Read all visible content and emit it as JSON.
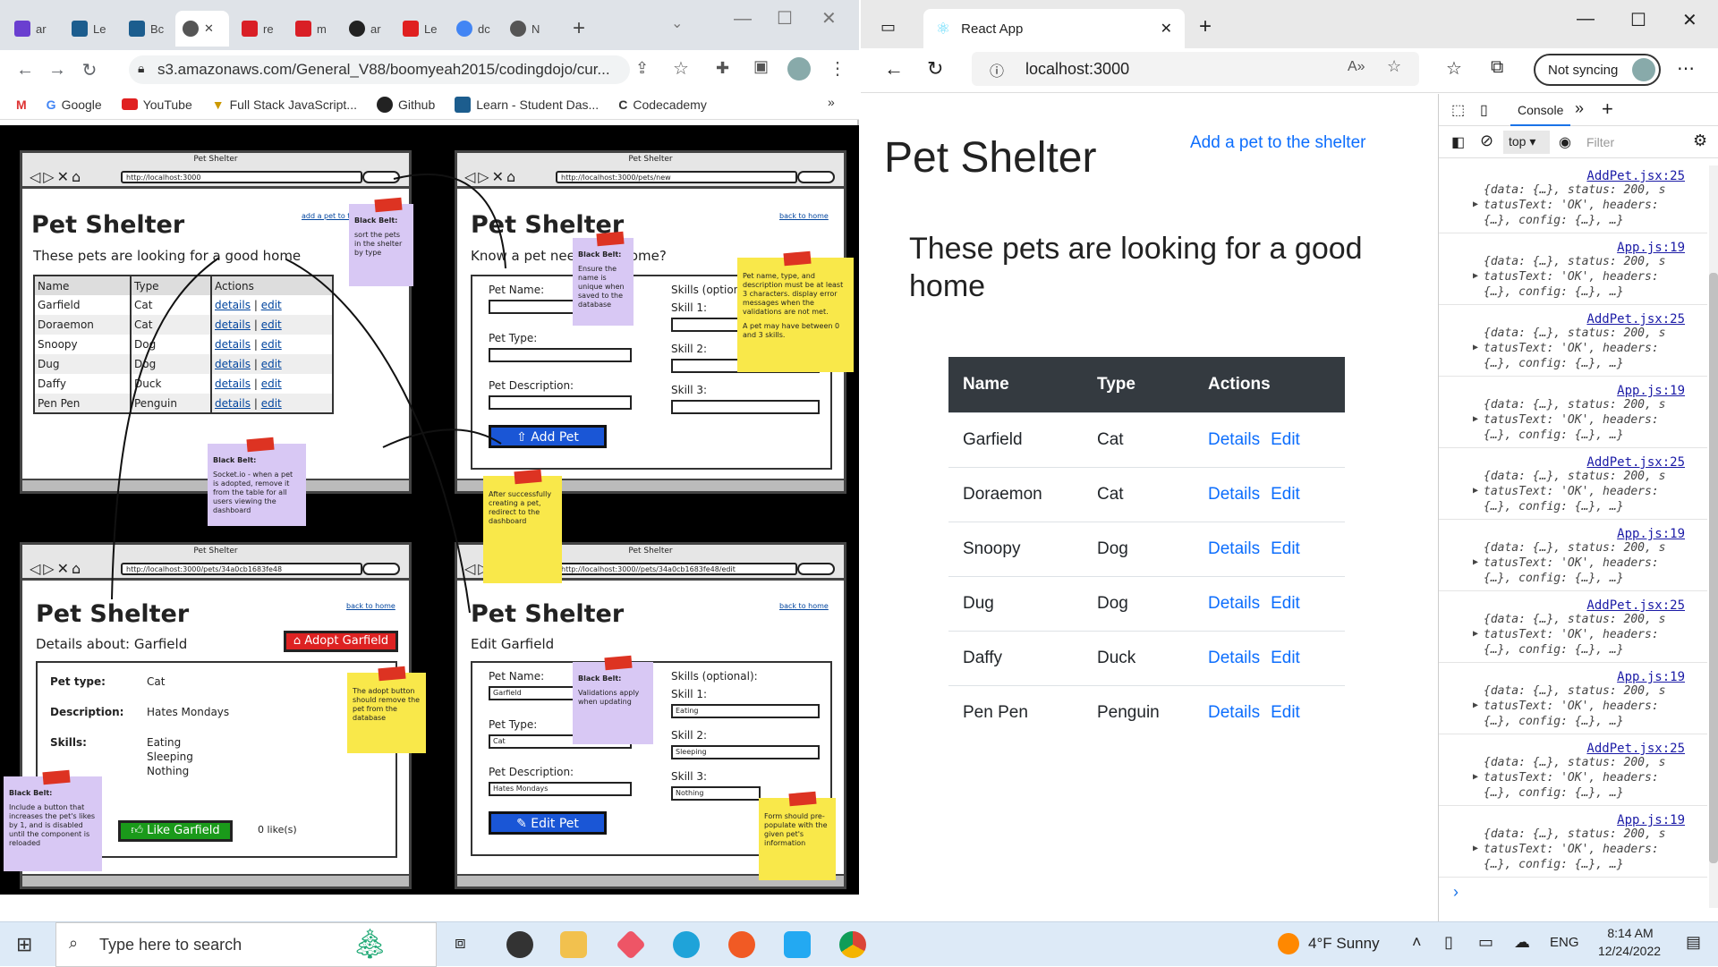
{
  "left_browser": {
    "tabs": [
      {
        "label": "ar",
        "color": "#6a3fd0"
      },
      {
        "label": "Le",
        "color": "#1c5d8e"
      },
      {
        "label": "Bc",
        "color": "#1c5d8e"
      },
      {
        "label": "",
        "color": "#555555"
      },
      {
        "label": "re",
        "color": "#d91f26"
      },
      {
        "label": "m",
        "color": "#d91f26"
      },
      {
        "label": "ar",
        "color": "#222222"
      },
      {
        "label": "Le",
        "color": "#e02020"
      },
      {
        "label": "dc",
        "color": "#4285f4"
      },
      {
        "label": "N",
        "color": "#555555"
      }
    ],
    "url": "s3.amazonaws.com/General_V88/boomyeah2015/codingdojo/cur...",
    "bookmarks": [
      "Google",
      "YouTube",
      "Full Stack JavaScript...",
      "Github",
      "Learn - Student Das...",
      "Codecademy"
    ],
    "more_bookmarks": "»"
  },
  "wireframe": {
    "frame_title": "Pet Shelter",
    "urls": [
      "http://localhost:3000",
      "http://localhost:3000/pets/new",
      "http://localhost:3000/pets/34a0cb1683fe48",
      "http://localhost:3000//pets/34a0cb1683fe48/edit"
    ],
    "heading": "Pet Shelter",
    "f1": {
      "link": "add a pet to the shelter",
      "sub": "These pets are looking for a good home",
      "cols": [
        "Name",
        "Type",
        "Actions"
      ],
      "rows": [
        [
          "Garfield",
          "Cat"
        ],
        [
          "Doraemon",
          "Cat"
        ],
        [
          "Snoopy",
          "Dog"
        ],
        [
          "Dug",
          "Dog"
        ],
        [
          "Daffy",
          "Duck"
        ],
        [
          "Pen Pen",
          "Penguin"
        ]
      ],
      "details": "details",
      "sep": "|",
      "edit": "edit"
    },
    "f2": {
      "link": "back to home",
      "sub": "Know a pet needing a home?",
      "name": "Pet Name:",
      "type": "Pet Type:",
      "desc": "Pet Description:",
      "skills": "Skills (optional):",
      "s1": "Skill 1:",
      "s2": "Skill 2:",
      "s3": "Skill 3:",
      "btn": "Add Pet"
    },
    "f3": {
      "link": "back to home",
      "sub": "Details about: Garfield",
      "adopt": "Adopt Garfield",
      "type_l": "Pet type:",
      "type_v": "Cat",
      "desc_l": "Description:",
      "desc_v": "Hates Mondays",
      "skills_l": "Skills:",
      "skills": [
        "Eating",
        "Sleeping",
        "Nothing"
      ],
      "like": "Like Garfield",
      "likes": "0 like(s)"
    },
    "f4": {
      "link": "back to home",
      "sub": "Edit Garfield",
      "name": "Pet Name:",
      "name_v": "Garfield",
      "type": "Pet Type:",
      "type_v": "Cat",
      "desc": "Pet Description:",
      "desc_v": "Hates Mondays",
      "skills": "Skills (optional):",
      "s1": "Skill 1:",
      "s1v": "Eating",
      "s2": "Skill 2:",
      "s2v": "Sleeping",
      "s3": "Skill 3:",
      "s3v": "Nothing",
      "btn": "Edit Pet"
    },
    "notes": {
      "n1": {
        "title": "Black Belt:",
        "body": "sort the pets in the shelter by type"
      },
      "n2": {
        "title": "Black Belt:",
        "body": "Ensure the name is unique when saved to the database"
      },
      "n3": {
        "body": "Pet name, type, and description must be at least 3 characters. display error messages when the validations are not met.",
        "body2": "A pet may have between 0 and 3 skills."
      },
      "n4": {
        "title": "Black Belt:",
        "body": "Socket.io - when a pet is adopted, remove it from the table for all users viewing the dashboard"
      },
      "n5": {
        "body": "After successfully creating a pet, redirect to the dashboard"
      },
      "n6": {
        "body": "The adopt button should remove the pet from the database"
      },
      "n7": {
        "title": "Black Belt:",
        "body": "Validations apply when updating"
      },
      "n8": {
        "title": "Black Belt:",
        "body": "Include a button that increases the pet's likes by 1, and is disabled until the component is reloaded"
      },
      "n9": {
        "body": "Form should pre-populate with the given pet's information"
      }
    }
  },
  "right_browser": {
    "tab_title": "React App",
    "url": "localhost:3000",
    "sync": "Not syncing",
    "app": {
      "title": "Pet Shelter",
      "add_link": "Add a pet to the shelter",
      "subtitle": "These pets are looking for a good home",
      "cols": [
        "Name",
        "Type",
        "Actions"
      ],
      "rows": [
        [
          "Garfield",
          "Cat"
        ],
        [
          "Doraemon",
          "Cat"
        ],
        [
          "Snoopy",
          "Dog"
        ],
        [
          "Dug",
          "Dog"
        ],
        [
          "Daffy",
          "Duck"
        ],
        [
          "Pen Pen",
          "Penguin"
        ]
      ],
      "details": "Details",
      "edit": "Edit"
    },
    "devtools": {
      "tab": "Console",
      "context": "top",
      "filter_placeholder": "Filter",
      "logs": [
        {
          "src": "AddPet.jsx:25",
          "l1": "{data: {…}, status: 200, s",
          "l2": "tatusText: 'OK', headers:",
          "l3": "{…}, config: {…}, …}"
        },
        {
          "src": "App.js:19",
          "l1": "{data: {…}, status: 200, s",
          "l2": "tatusText: 'OK', headers:",
          "l3": "{…}, config: {…}, …}"
        },
        {
          "src": "AddPet.jsx:25",
          "l1": "{data: {…}, status: 200, s",
          "l2": "tatusText: 'OK', headers:",
          "l3": "{…}, config: {…}, …}"
        },
        {
          "src": "App.js:19",
          "l1": "{data: {…}, status: 200, s",
          "l2": "tatusText: 'OK', headers:",
          "l3": "{…}, config: {…}, …}"
        },
        {
          "src": "AddPet.jsx:25",
          "l1": "{data: {…}, status: 200, s",
          "l2": "tatusText: 'OK', headers:",
          "l3": "{…}, config: {…}, …}"
        },
        {
          "src": "App.js:19",
          "l1": "{data: {…}, status: 200, s",
          "l2": "tatusText: 'OK', headers:",
          "l3": "{…}, config: {…}, …}"
        },
        {
          "src": "AddPet.jsx:25",
          "l1": "{data: {…}, status: 200, s",
          "l2": "tatusText: 'OK', headers:",
          "l3": "{…}, config: {…}, …}"
        },
        {
          "src": "App.js:19",
          "l1": "{data: {…}, status: 200, s",
          "l2": "tatusText: 'OK', headers:",
          "l3": "{…}, config: {…}, …}"
        },
        {
          "src": "AddPet.jsx:25",
          "l1": "{data: {…}, status: 200, s",
          "l2": "tatusText: 'OK', headers:",
          "l3": "{…}, config: {…}, …}"
        },
        {
          "src": "App.js:19",
          "l1": "{data: {…}, status: 200, s",
          "l2": "tatusText: 'OK', headers:",
          "l3": "{…}, config: {…}, …}"
        }
      ],
      "prompt": "›"
    }
  },
  "taskbar": {
    "search": "Type here to search",
    "weather": "4°F  Sunny",
    "lang": "ENG",
    "time": "8:14 AM",
    "date": "12/24/2022"
  }
}
